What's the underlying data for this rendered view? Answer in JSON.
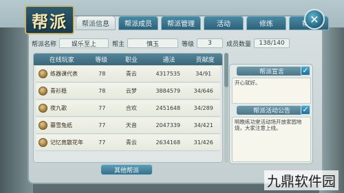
{
  "banner": {
    "title": "帮派"
  },
  "tabs": [
    {
      "label": "帮派信息",
      "active": true
    },
    {
      "label": "帮派成员",
      "active": false
    },
    {
      "label": "帮派管理",
      "active": false
    },
    {
      "label": "活动",
      "active": false
    },
    {
      "label": "修炼",
      "active": false
    },
    {
      "label": "帮战",
      "active": false
    }
  ],
  "close": {
    "icon": "✕"
  },
  "info": {
    "name_label": "帮派名称",
    "name_value": "娱乐至上",
    "leader_label": "帮主",
    "leader_value": "慎玉",
    "level_label": "等级",
    "level_value": "3",
    "members_label": "成员数量",
    "members_value": "138/140"
  },
  "table": {
    "headers": [
      "在线玩家",
      "等级",
      "职业",
      "通法",
      "贡献度"
    ],
    "rows": [
      {
        "name": "练器课代表",
        "level": "78",
        "job": "青云",
        "power": "4317535",
        "contrib": "34/91"
      },
      {
        "name": "青衫稳",
        "level": "78",
        "job": "云梦",
        "power": "3884579",
        "contrib": "34/646"
      },
      {
        "name": "夜九歌",
        "level": "77",
        "job": "合欢",
        "power": "2451648",
        "contrib": "34/289"
      },
      {
        "name": "暮雪兔纸",
        "level": "77",
        "job": "天音",
        "power": "2047339",
        "contrib": "34/421"
      },
      {
        "name": "记忆竟散花年",
        "level": "77",
        "job": "青云",
        "power": "2634168",
        "contrib": "31/426"
      }
    ]
  },
  "side": {
    "notice_title": "帮派宣言",
    "notice_text": "开心就好。",
    "activity_title": "帮派活动公告",
    "activity_text": "明晚练功堂活动场开放家园地烧，大家注意上线。",
    "check_icon": "✓"
  },
  "other_button": {
    "label": "其他帮派"
  },
  "watermark": {
    "text": "九鼎软件园"
  }
}
